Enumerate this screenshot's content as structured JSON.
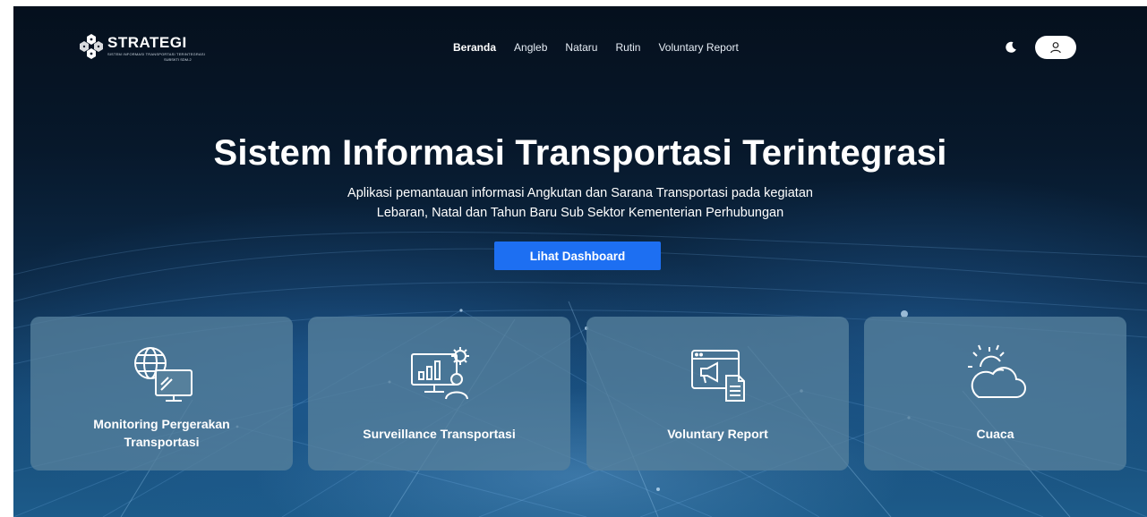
{
  "header": {
    "logo_name": "STRATEGI",
    "logo_tagline": "SISTEM INFORMASI TRANSPORTASI TERINTEGRASI",
    "logo_sub": "SUBSKTI SDM-2",
    "nav": [
      {
        "label": "Beranda",
        "active": true
      },
      {
        "label": "Angleb",
        "active": false
      },
      {
        "label": "Nataru",
        "active": false
      },
      {
        "label": "Rutin",
        "active": false
      },
      {
        "label": "Voluntary Report",
        "active": false
      }
    ],
    "theme_icon": "moon-icon",
    "user_icon": "user-icon"
  },
  "hero": {
    "title": "Sistem Informasi Transportasi Terintegrasi",
    "subtitle_line1": "Aplikasi pemantauan informasi Angkutan dan Sarana Transportasi pada kegiatan",
    "subtitle_line2": "Lebaran, Natal dan Tahun Baru Sub Sektor Kementerian Perhubungan",
    "cta_label": "Lihat Dashboard"
  },
  "cards": [
    {
      "label_line1": "Monitoring Pergerakan",
      "label_line2": "Transportasi",
      "icon": "globe-monitor-icon"
    },
    {
      "label_line1": "Surveillance Transportasi",
      "icon": "surveillance-analytics-icon"
    },
    {
      "label_line1": "Voluntary Report",
      "icon": "megaphone-report-icon"
    },
    {
      "label_line1": "Cuaca",
      "icon": "weather-cloud-sun-icon"
    }
  ],
  "colors": {
    "accent": "#1d6ff2",
    "card_bg": "#56809c",
    "bg_dark": "#07182b"
  }
}
